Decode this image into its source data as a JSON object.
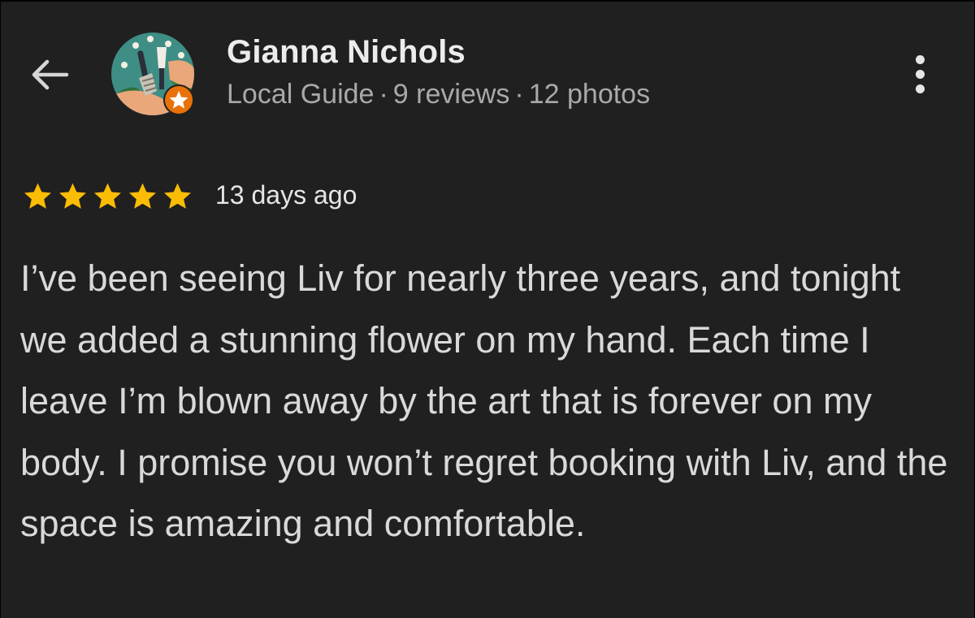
{
  "header": {
    "back_icon": "arrow-left-icon",
    "avatar_icon": "garden-tools-avatar-icon",
    "badge_icon": "local-guide-star-icon",
    "more_icon": "more-vertical-icon",
    "user_name": "Gianna Nichols",
    "meta": {
      "role": "Local Guide",
      "separator": "·",
      "reviews": "9 reviews",
      "photos": "12 photos"
    }
  },
  "review": {
    "rating": 5,
    "rating_max": 5,
    "star_color": "#fbbc04",
    "date": "13 days ago",
    "text": "I’ve been seeing Liv for nearly three years, and tonight we added a stunning flower on my hand. Each time I leave I’m blown away by the art that is forever on my body. I promise you won’t regret booking with Liv, and the space is amazing and comfortable."
  },
  "colors": {
    "background": "#202020",
    "primary_text": "#ececec",
    "secondary_text": "#a9a9a9",
    "badge_orange": "#e8710a"
  }
}
